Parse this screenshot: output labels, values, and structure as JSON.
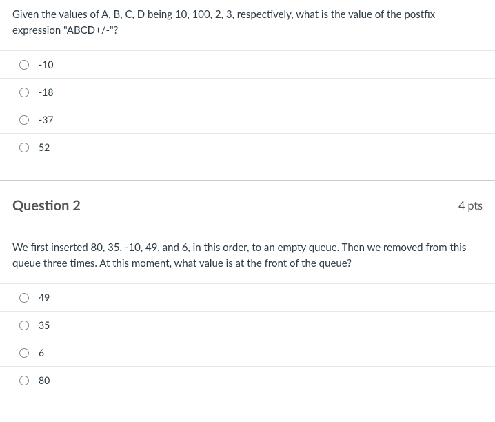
{
  "question1": {
    "prompt": "Given the values of A, B, C, D being 10, 100, 2, 3, respectively, what is the value of the postfix expression \"ABCD+/-\"?",
    "options": [
      "-10",
      "-18",
      "-37",
      "52"
    ]
  },
  "question2": {
    "heading": "Question 2",
    "points": "4 pts",
    "prompt": "We first inserted 80, 35, -10, 49, and 6, in this order, to an empty queue.  Then we removed from this queue three times.  At this moment, what value is at the front of the queue?",
    "options": [
      "49",
      "35",
      "6",
      "80"
    ]
  }
}
